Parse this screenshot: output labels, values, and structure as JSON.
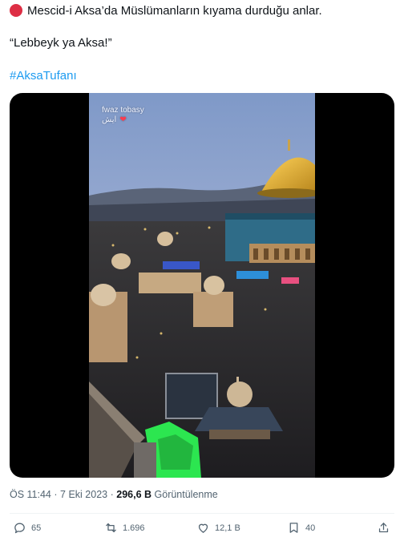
{
  "tweet": {
    "line1": "Mescid-i Aksa’da Müslümanların kıyama durduğu anlar.",
    "line2": "“Lebbeyk ya Aksa!”",
    "hashtag": "#AksaTufanı"
  },
  "video": {
    "watermark_line1": "fwaz tobasy",
    "watermark_line2": "ایش",
    "watermark_heart": "❤"
  },
  "meta": {
    "time": "ÖS 11:44",
    "separator": "·",
    "date": "7 Eki 2023",
    "views_count": "296,6 B",
    "views_label": "Görüntülenme"
  },
  "actions": {
    "replies": "65",
    "reposts": "1.696",
    "likes": "12,1 B",
    "bookmarks": "40"
  },
  "colors": {
    "emoji_red": "#dd2e44",
    "link_blue": "#1d9bf0",
    "muted": "#536471"
  },
  "icons": [
    "red-circle-icon",
    "reply-icon",
    "repost-icon",
    "like-icon",
    "bookmark-icon",
    "share-icon"
  ]
}
